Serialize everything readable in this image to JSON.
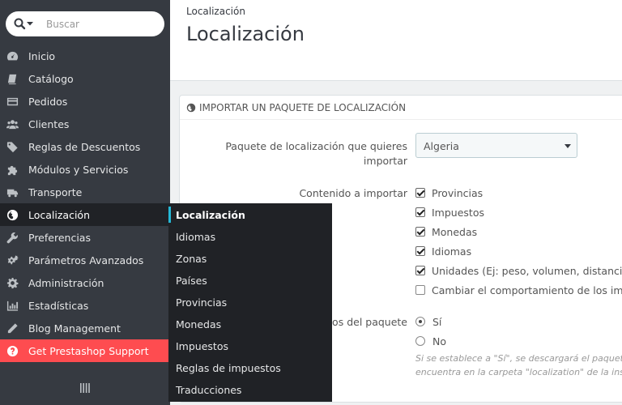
{
  "search": {
    "placeholder": "Buscar"
  },
  "sidebar": {
    "items": [
      {
        "label": "Inicio",
        "icon": "dashboard-icon"
      },
      {
        "label": "Catálogo",
        "icon": "book-icon"
      },
      {
        "label": "Pedidos",
        "icon": "credit-card-icon"
      },
      {
        "label": "Clientes",
        "icon": "users-icon"
      },
      {
        "label": "Reglas de Descuentos",
        "icon": "tags-icon"
      },
      {
        "label": "Módulos y Servicios",
        "icon": "puzzle-icon"
      },
      {
        "label": "Transporte",
        "icon": "truck-icon"
      },
      {
        "label": "Localización",
        "icon": "globe-icon",
        "active": true
      },
      {
        "label": "Preferencias",
        "icon": "wrench-icon"
      },
      {
        "label": "Parámetros Avanzados",
        "icon": "cogs-icon"
      },
      {
        "label": "Administración",
        "icon": "cog-icon"
      },
      {
        "label": "Estadísticas",
        "icon": "bar-chart-icon"
      },
      {
        "label": "Blog Management",
        "icon": "pencil-icon"
      },
      {
        "label": "Get Prestashop Support",
        "icon": "question-circle-icon"
      }
    ]
  },
  "submenu": {
    "items": [
      "Localización",
      "Idiomas",
      "Zonas",
      "Países",
      "Provincias",
      "Monedas",
      "Impuestos",
      "Reglas de impuestos",
      "Traducciones"
    ]
  },
  "header": {
    "breadcrumb": "Localización",
    "title": "Localización"
  },
  "panel": {
    "heading": "IMPORTAR UN PAQUETE DE LOCALIZACIÓN",
    "package_label": "Paquete de localización que quieres importar",
    "package_value": "Algeria",
    "content_label": "Contenido a importar",
    "content_options": [
      {
        "label": "Provincias",
        "checked": true
      },
      {
        "label": "Impuestos",
        "checked": true
      },
      {
        "label": "Monedas",
        "checked": true
      },
      {
        "label": "Idiomas",
        "checked": true
      },
      {
        "label": "Unidades (Ej: peso, volumen, distancia)",
        "checked": true
      },
      {
        "label": "Cambiar el comportamiento de los impues",
        "checked": false
      }
    ],
    "download_label": "tos del paquete",
    "download_options": [
      {
        "label": "Sí",
        "checked": true
      },
      {
        "label": "No",
        "checked": false
      }
    ],
    "help_line1": "Si se establece a \"Sí\", se descargará el paquete",
    "help_line2": "encuentra en la carpeta \"localization\" de la ins"
  },
  "colors": {
    "sidebar_bg": "#363a41",
    "submenu_bg": "#202226",
    "support_bg": "#fe4c50",
    "accent": "#25b9d7"
  }
}
